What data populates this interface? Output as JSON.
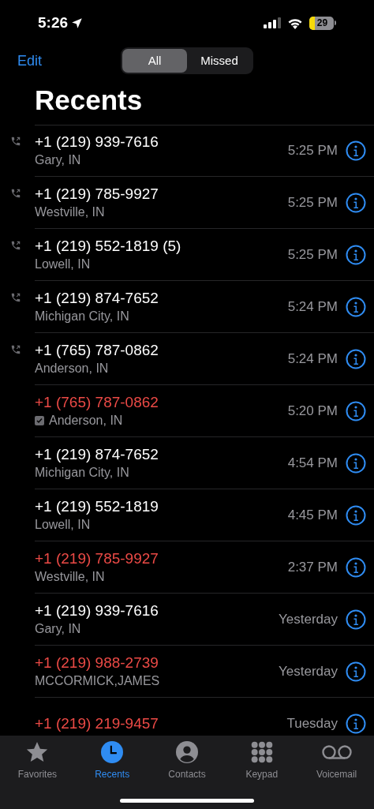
{
  "status_bar": {
    "time": "5:26",
    "battery": "29"
  },
  "nav": {
    "edit": "Edit",
    "segments": [
      {
        "label": "All",
        "selected": true
      },
      {
        "label": "Missed",
        "selected": false
      }
    ]
  },
  "title": "Recents",
  "calls": [
    {
      "number": "+1 (219) 939-7616",
      "detail": "Gary, IN",
      "time": "5:25 PM",
      "missed": false,
      "outgoing": true
    },
    {
      "number": "+1 (219) 785-9927",
      "detail": "Westville, IN",
      "time": "5:25 PM",
      "missed": false,
      "outgoing": true
    },
    {
      "number": "+1 (219) 552-1819 (5)",
      "detail": "Lowell, IN",
      "time": "5:25 PM",
      "missed": false,
      "outgoing": true
    },
    {
      "number": "+1 (219) 874-7652",
      "detail": "Michigan City, IN",
      "time": "5:24 PM",
      "missed": false,
      "outgoing": true
    },
    {
      "number": "+1 (765) 787-0862",
      "detail": "Anderson, IN",
      "time": "5:24 PM",
      "missed": false,
      "outgoing": true
    },
    {
      "number": "+1 (765) 787-0862",
      "detail": "Anderson, IN",
      "time": "5:20 PM",
      "missed": true,
      "outgoing": false,
      "verified": true
    },
    {
      "number": "+1 (219) 874-7652",
      "detail": "Michigan City, IN",
      "time": "4:54 PM",
      "missed": false,
      "outgoing": false
    },
    {
      "number": "+1 (219) 552-1819",
      "detail": "Lowell, IN",
      "time": "4:45 PM",
      "missed": false,
      "outgoing": false
    },
    {
      "number": "+1 (219) 785-9927",
      "detail": "Westville, IN",
      "time": "2:37 PM",
      "missed": true,
      "outgoing": false
    },
    {
      "number": "+1 (219) 939-7616",
      "detail": "Gary, IN",
      "time": "Yesterday",
      "missed": false,
      "outgoing": false
    },
    {
      "number": "+1 (219) 988-2739",
      "detail": "MCCORMICK,JAMES",
      "time": "Yesterday",
      "missed": true,
      "outgoing": false
    },
    {
      "number": "+1 (219) 219-9457",
      "time": "Tuesday",
      "missed": true,
      "outgoing": false
    }
  ],
  "tab_bar": [
    {
      "label": "Favorites",
      "kind": "star",
      "selected": false
    },
    {
      "label": "Recents",
      "kind": "clock",
      "selected": true
    },
    {
      "label": "Contacts",
      "kind": "person",
      "selected": false
    },
    {
      "label": "Keypad",
      "kind": "keypad",
      "selected": false
    },
    {
      "label": "Voicemail",
      "kind": "voicemail",
      "selected": false
    }
  ]
}
